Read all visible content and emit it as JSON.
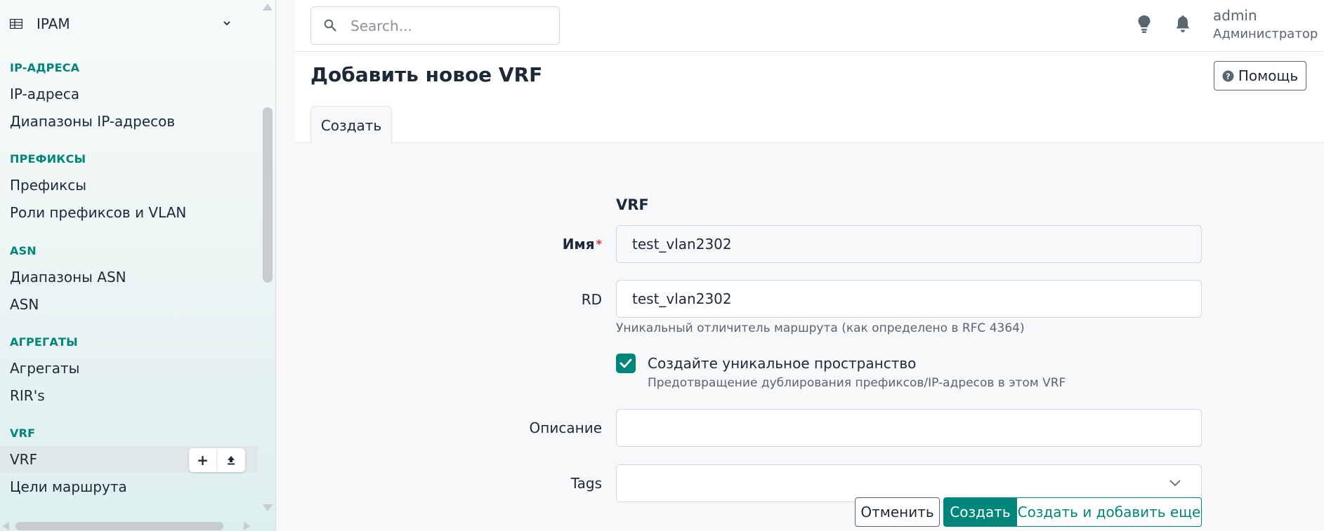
{
  "sidebar": {
    "app_title": "IPAM",
    "sections": [
      {
        "title": "IP-АДРЕСА",
        "items": [
          {
            "label": "IP-адреса"
          },
          {
            "label": "Диапазоны IP-адресов"
          }
        ]
      },
      {
        "title": "ПРЕФИКСЫ",
        "items": [
          {
            "label": "Префиксы"
          },
          {
            "label": "Роли префиксов и VLAN"
          }
        ]
      },
      {
        "title": "ASN",
        "items": [
          {
            "label": "Диапазоны ASN"
          },
          {
            "label": "ASN"
          }
        ]
      },
      {
        "title": "АГРЕГАТЫ",
        "items": [
          {
            "label": "Агрегаты"
          },
          {
            "label": "RIR's"
          }
        ]
      },
      {
        "title": "VRF",
        "items": [
          {
            "label": "VRF",
            "active": true
          },
          {
            "label": "Цели маршрута"
          }
        ]
      }
    ],
    "item_actions": {
      "add": "+",
      "import": "⬆"
    }
  },
  "topbar": {
    "search_placeholder": "Search...",
    "user": {
      "name": "admin",
      "role": "Администратор"
    },
    "icons": [
      "lightbulb-icon",
      "bell-icon"
    ]
  },
  "page": {
    "title": "Добавить новое VRF",
    "help_label": "Помощь",
    "tabs": [
      {
        "label": "Создать",
        "active": true
      }
    ]
  },
  "form": {
    "section_title": "VRF",
    "name": {
      "label": "Имя",
      "required_mark": "*",
      "value": "test_vlan2302"
    },
    "rd": {
      "label": "RD",
      "value": "test_vlan2302",
      "help": "Уникальный отличитель маршрута (как определено в RFC 4364)"
    },
    "enforce_unique": {
      "label": "Создайте уникальное пространство",
      "checked": true,
      "help": "Предотвращение дублирования префиксов/IP-адресов в этом VRF"
    },
    "description": {
      "label": "Описание",
      "value": ""
    },
    "tags": {
      "label": "Tags",
      "value": ""
    }
  },
  "actions": {
    "cancel": "Отменить",
    "create": "Создать",
    "create_and_add": "Создать и добавить еще"
  },
  "colors": {
    "accent": "#00857a",
    "text": "#1d2939",
    "muted": "#59656f",
    "required": "#d63939"
  }
}
